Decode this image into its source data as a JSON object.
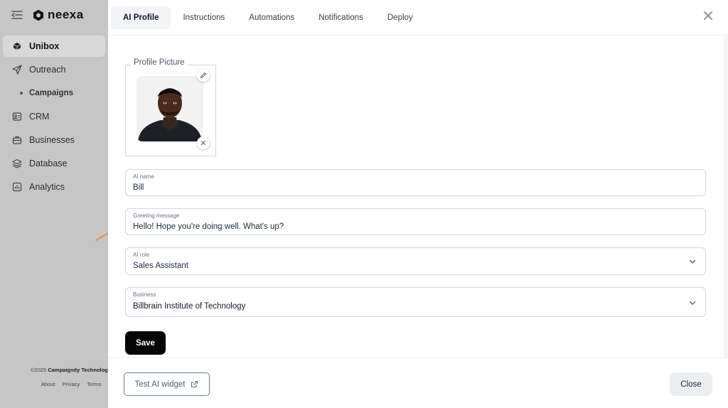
{
  "brand": {
    "name": "neexa"
  },
  "sidebar": {
    "items": [
      {
        "label": "Unibox",
        "icon": "unibox-icon",
        "active": true
      },
      {
        "label": "Outreach",
        "icon": "send-icon"
      },
      {
        "label": "Campaigns",
        "icon": "dot",
        "sub": true
      },
      {
        "label": "CRM",
        "icon": "crm-icon"
      },
      {
        "label": "Businesses",
        "icon": "briefcase-icon"
      },
      {
        "label": "Database",
        "icon": "database-icon"
      },
      {
        "label": "Analytics",
        "icon": "analytics-icon"
      }
    ],
    "copyright_prefix": "©2025",
    "copyright_company": "Campaignity Technolog",
    "links": [
      "About",
      "Privacy",
      "Terms"
    ]
  },
  "tabs": [
    {
      "label": "AI Profile",
      "active": true
    },
    {
      "label": "Instructions"
    },
    {
      "label": "Automations"
    },
    {
      "label": "Notifications"
    },
    {
      "label": "Deploy"
    }
  ],
  "profile": {
    "picture_label": "Profile Picture"
  },
  "fields": {
    "ai_name": {
      "label": "AI name",
      "value": "Bill"
    },
    "greeting": {
      "label": "Greeting message",
      "value": "Hello! Hope you're doing well. What's up?"
    },
    "ai_role": {
      "label": "AI role",
      "value": "Sales Assistant"
    },
    "business": {
      "label": "Business",
      "value": "Billbrain Institute of Technology"
    }
  },
  "buttons": {
    "save": "Save",
    "test_widget": "Test AI widget",
    "close": "Close"
  },
  "colors": {
    "annotation_arrow": "#f28b1e",
    "primary_button": "#050505"
  }
}
